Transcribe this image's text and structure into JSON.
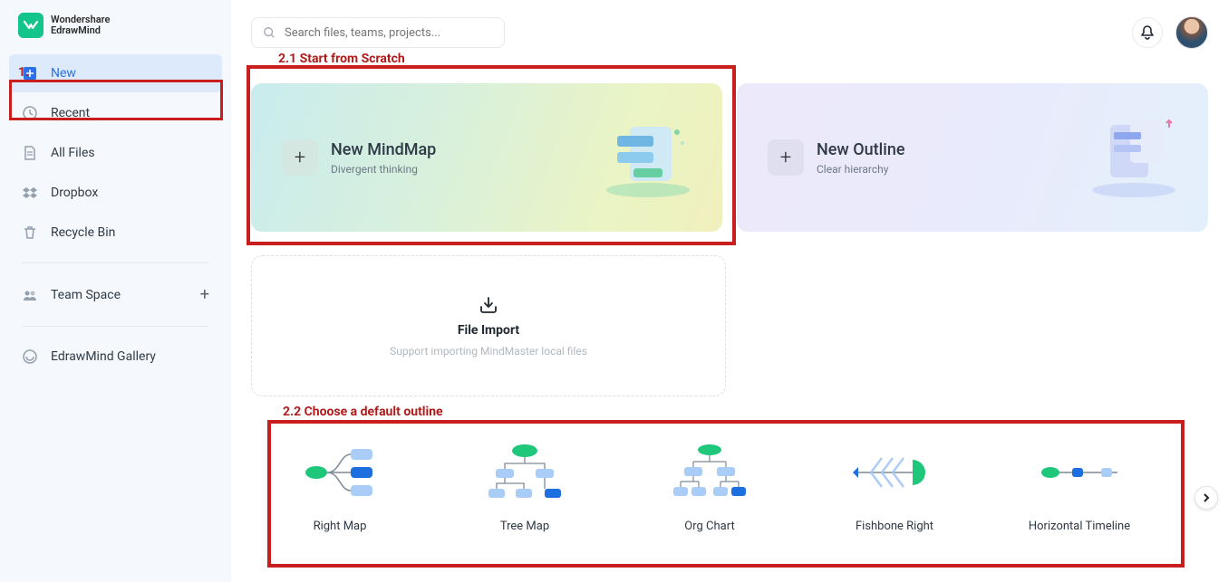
{
  "brand": {
    "line1": "Wondershare",
    "line2": "EdrawMind"
  },
  "annotations": {
    "step1": "1.",
    "step21": "2.1 Start from Scratch",
    "step22": "2.2 Choose a default outline"
  },
  "sidebar": {
    "items": [
      {
        "label": "New",
        "icon": "plus-doc"
      },
      {
        "label": "Recent",
        "icon": "clock"
      },
      {
        "label": "All Files",
        "icon": "doc"
      },
      {
        "label": "Dropbox",
        "icon": "dropbox"
      },
      {
        "label": "Recycle Bin",
        "icon": "trash"
      }
    ],
    "team": {
      "label": "Team Space"
    },
    "gallery": {
      "label": "EdrawMind Gallery"
    }
  },
  "search": {
    "placeholder": "Search files, teams, projects..."
  },
  "cards": {
    "mindmap": {
      "title": "New MindMap",
      "subtitle": "Divergent thinking"
    },
    "outline": {
      "title": "New Outline",
      "subtitle": "Clear hierarchy"
    }
  },
  "import": {
    "title": "File Import",
    "subtitle": "Support importing MindMaster local files"
  },
  "templates": [
    {
      "label": "Right Map"
    },
    {
      "label": "Tree Map"
    },
    {
      "label": "Org Chart"
    },
    {
      "label": "Fishbone Right"
    },
    {
      "label": "Horizontal Timeline"
    }
  ]
}
